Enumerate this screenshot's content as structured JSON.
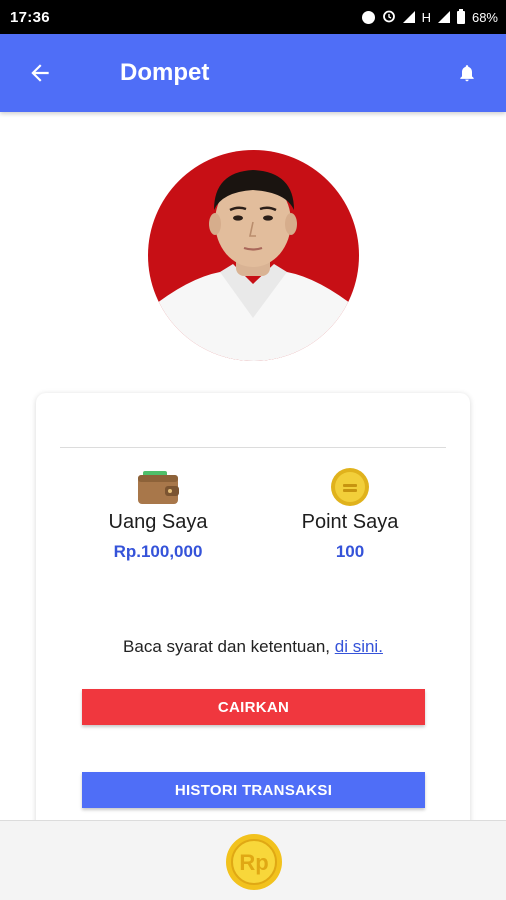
{
  "status_bar": {
    "time": "17:36",
    "network": "H",
    "battery": "68%"
  },
  "app_bar": {
    "title": "Dompet",
    "back_icon": "arrow-back-icon",
    "bell_icon": "bell-icon"
  },
  "profile": {
    "avatar": "profile-photo"
  },
  "wallet": {
    "money_label": "Uang Saya",
    "money_value": "Rp.100,000",
    "money_icon": "wallet-icon",
    "point_label": "Point Saya",
    "point_value": "100",
    "point_icon": "coin-icon"
  },
  "terms": {
    "text": "Baca syarat dan ketentuan, ",
    "link": "di sini."
  },
  "buttons": {
    "withdraw": "CAIRKAN",
    "history": "HISTORI TRANSAKSI"
  },
  "bottom_bar": {
    "coin_text": "Rp",
    "coin_icon": "rupiah-coin-icon"
  },
  "colors": {
    "primary": "#4f6ef7",
    "danger": "#f0373e",
    "value_text": "#3553d9"
  }
}
